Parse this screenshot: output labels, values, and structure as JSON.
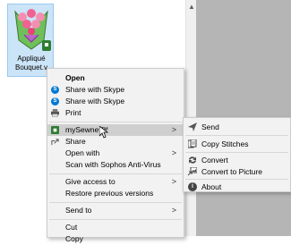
{
  "file": {
    "label_line1": "Appliqué",
    "label_line2": "Bouquet.v"
  },
  "context_menu": {
    "open": "Open",
    "share_skype_1": "Share with Skype",
    "share_skype_2": "Share with Skype",
    "print": "Print",
    "mysewnet": "mySewnet™",
    "share": "Share",
    "open_with": "Open with",
    "scan": "Scan with Sophos Anti-Virus",
    "give_access": "Give access to",
    "restore": "Restore previous versions",
    "send_to": "Send to",
    "cut": "Cut",
    "copy": "Copy"
  },
  "submenu": {
    "send": "Send",
    "copy_stitches": "Copy Stitches",
    "convert": "Convert",
    "convert_picture": "Convert to Picture",
    "about": "About"
  },
  "colors": {
    "grey_pane": "#b5b5b5",
    "menu_bg": "#f2f2f2",
    "hover": "#cfcfcf",
    "skype": "#0078d4",
    "selection": "#cce4f7"
  }
}
